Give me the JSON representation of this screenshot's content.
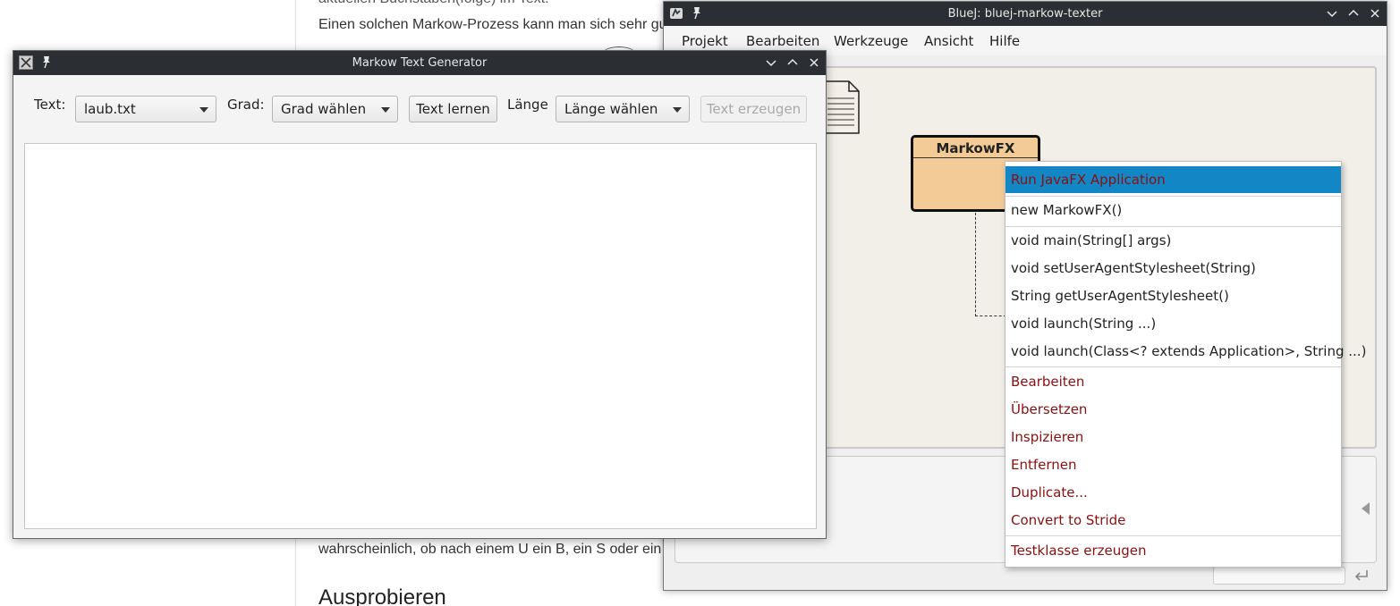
{
  "background_doc": {
    "line_0": "aktuellen Buchstaben(folge) im Text.",
    "line_1": "Einen solchen Markow-Prozess kann man sich sehr gut",
    "line_2": "wahrscheinlich, ob nach einem U ein B, ein S oder ein",
    "heading": "Ausprobieren"
  },
  "bluej": {
    "title": "BlueJ: bluej-markow-texter",
    "menu": [
      "Projekt",
      "Bearbeiten",
      "Werkzeuge",
      "Ansicht",
      "Hilfe"
    ],
    "class_name": "MarkowFX"
  },
  "context_menu": {
    "items": [
      {
        "label": "Run JavaFX Application",
        "style": "selected"
      },
      {
        "label": "new MarkowFX()",
        "style": "plain"
      },
      {
        "label": "void main(String[] args)",
        "style": "plain"
      },
      {
        "label": "void setUserAgentStylesheet(String)",
        "style": "plain"
      },
      {
        "label": "String getUserAgentStylesheet()",
        "style": "plain"
      },
      {
        "label": "void launch(String ...)",
        "style": "plain"
      },
      {
        "label": "void launch(Class<? extends Application>, String ...)",
        "style": "plain"
      },
      {
        "label": "Bearbeiten",
        "style": "red"
      },
      {
        "label": "Übersetzen",
        "style": "red"
      },
      {
        "label": "Inspizieren",
        "style": "red"
      },
      {
        "label": "Entfernen",
        "style": "red"
      },
      {
        "label": "Duplicate...",
        "style": "red"
      },
      {
        "label": "Convert to Stride",
        "style": "red"
      },
      {
        "label": "Testklasse erzeugen",
        "style": "red"
      }
    ]
  },
  "markow": {
    "title": "Markow Text Generator",
    "text_label": "Text:",
    "text_value": "laub.txt",
    "grad_label": "Grad:",
    "grad_value": "Grad wählen",
    "learn_button": "Text lernen",
    "length_label": "Länge",
    "length_value": "Länge wählen",
    "generate_button": "Text erzeugen",
    "output_text": ""
  },
  "colors": {
    "titlebar": "#2b2e33",
    "selection": "#1387c6",
    "menu_red": "#8b0f0f",
    "class_fill": "#f2cb96"
  },
  "icons": [
    "markow-app-icon",
    "bluej-app-icon",
    "pin-icon",
    "minimize-icon",
    "maximize-icon",
    "close-icon",
    "readme-file-icon",
    "return-icon"
  ]
}
